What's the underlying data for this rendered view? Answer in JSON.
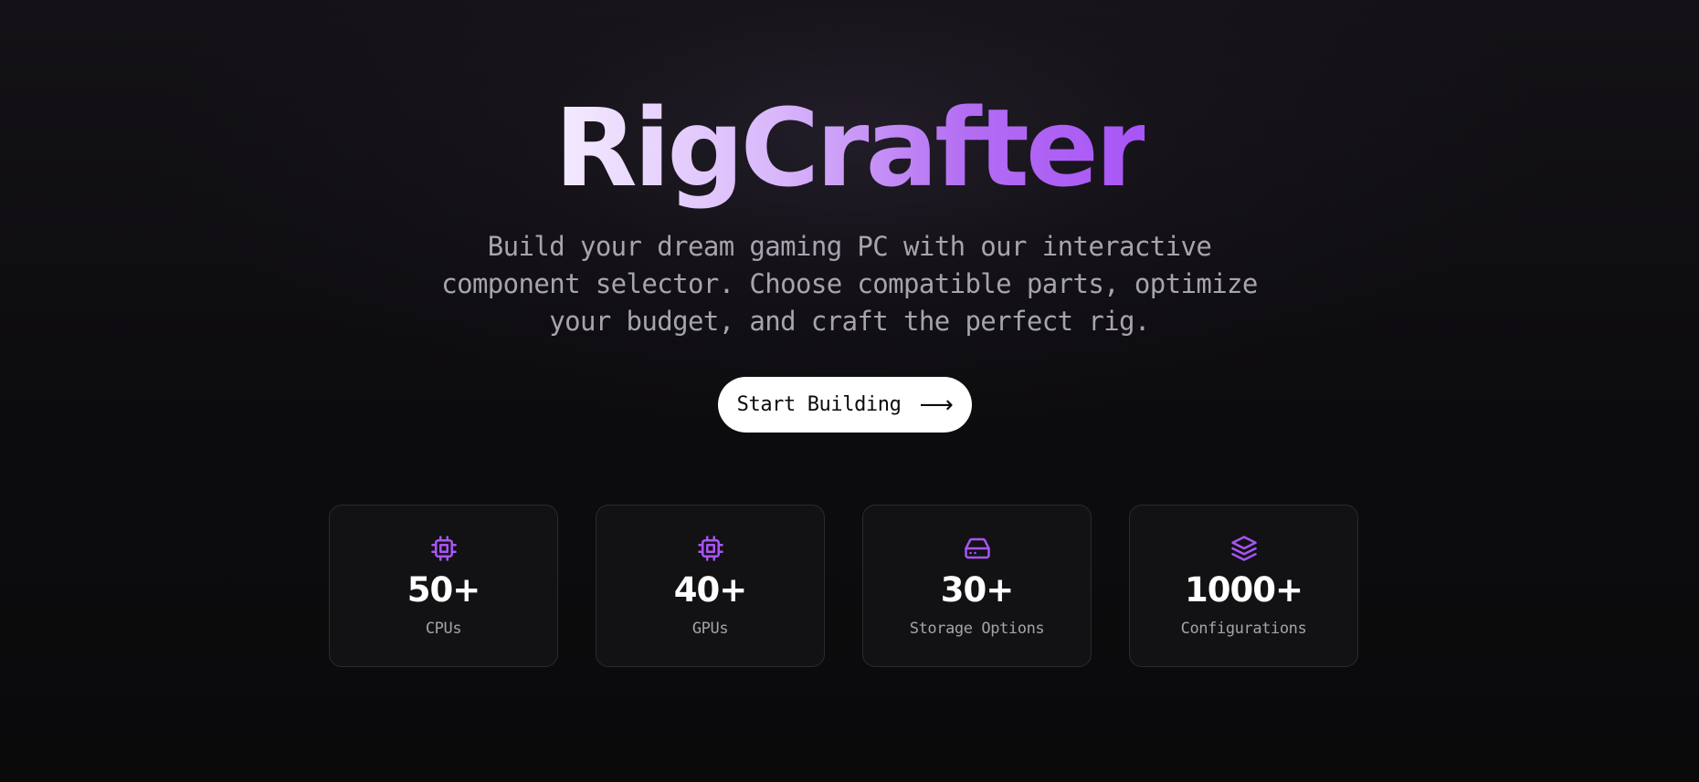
{
  "hero": {
    "title": "RigCrafter",
    "subtitle": "Build your dream gaming PC with our interactive component selector. Choose compatible parts, optimize your budget, and craft the perfect rig.",
    "cta_label": "Start Building",
    "cta_icon": "arrow-right-icon"
  },
  "colors": {
    "background": "#0a0a0b",
    "accent": "#a855f7",
    "card_background": "#121215",
    "card_border": "#2a2a30",
    "muted_text": "#a7a4ad"
  },
  "stats": [
    {
      "icon": "cpu-icon",
      "value": "50+",
      "label": "CPUs"
    },
    {
      "icon": "cpu-icon",
      "value": "40+",
      "label": "GPUs"
    },
    {
      "icon": "hard-drive-icon",
      "value": "30+",
      "label": "Storage Options"
    },
    {
      "icon": "layers-icon",
      "value": "1000+",
      "label": "Configurations"
    }
  ]
}
